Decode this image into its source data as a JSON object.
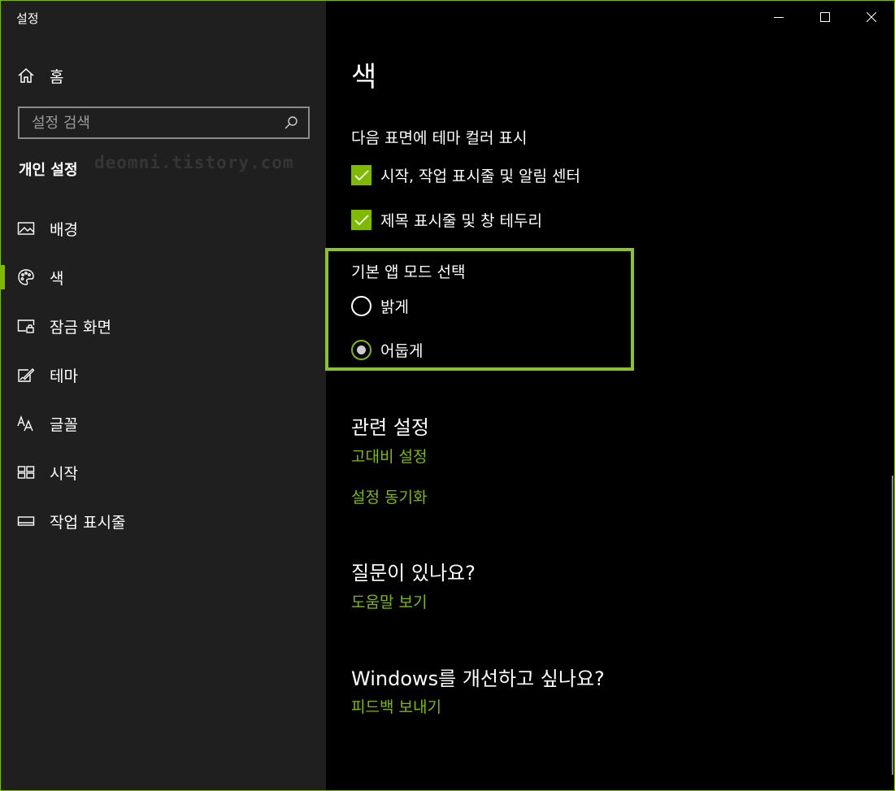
{
  "window": {
    "title": "설정"
  },
  "titlebar": {
    "minimize_icon": "minimize-icon",
    "maximize_icon": "maximize-icon",
    "close_icon": "close-icon"
  },
  "sidebar": {
    "home_label": "홈",
    "search_placeholder": "설정 검색",
    "section_title": "개인 설정",
    "watermark": "deomni.tistory.com",
    "items": [
      {
        "label": "배경",
        "icon": "picture-icon",
        "active": false
      },
      {
        "label": "색",
        "icon": "palette-icon",
        "active": true
      },
      {
        "label": "잠금 화면",
        "icon": "lock-screen-icon",
        "active": false
      },
      {
        "label": "테마",
        "icon": "theme-icon",
        "active": false
      },
      {
        "label": "글꼴",
        "icon": "font-icon",
        "active": false
      },
      {
        "label": "시작",
        "icon": "start-icon",
        "active": false
      },
      {
        "label": "작업 표시줄",
        "icon": "taskbar-icon",
        "active": false
      }
    ]
  },
  "main": {
    "title": "색",
    "theme_color_heading": "다음 표면에 테마 컬러 표시",
    "checkboxes": [
      {
        "label": "시작, 작업 표시줄 및 알림 센터",
        "checked": true
      },
      {
        "label": "제목 표시줄 및 창 테두리",
        "checked": true
      }
    ],
    "app_mode": {
      "heading": "기본 앱 모드 선택",
      "options": [
        {
          "label": "밝게",
          "selected": false
        },
        {
          "label": "어둡게",
          "selected": true
        }
      ]
    },
    "related": {
      "heading": "관련 설정",
      "links": [
        "고대비 설정",
        "설정 동기화"
      ]
    },
    "question": {
      "heading": "질문이 있나요?",
      "link": "도움말 보기"
    },
    "feedback": {
      "heading": "Windows를 개선하고 싶나요?",
      "link": "피드백 보내기"
    }
  },
  "colors": {
    "accent": "#7fba00",
    "sidebar_bg": "#1f1f1f",
    "content_bg": "#000000",
    "highlight": "#8bc42a"
  }
}
